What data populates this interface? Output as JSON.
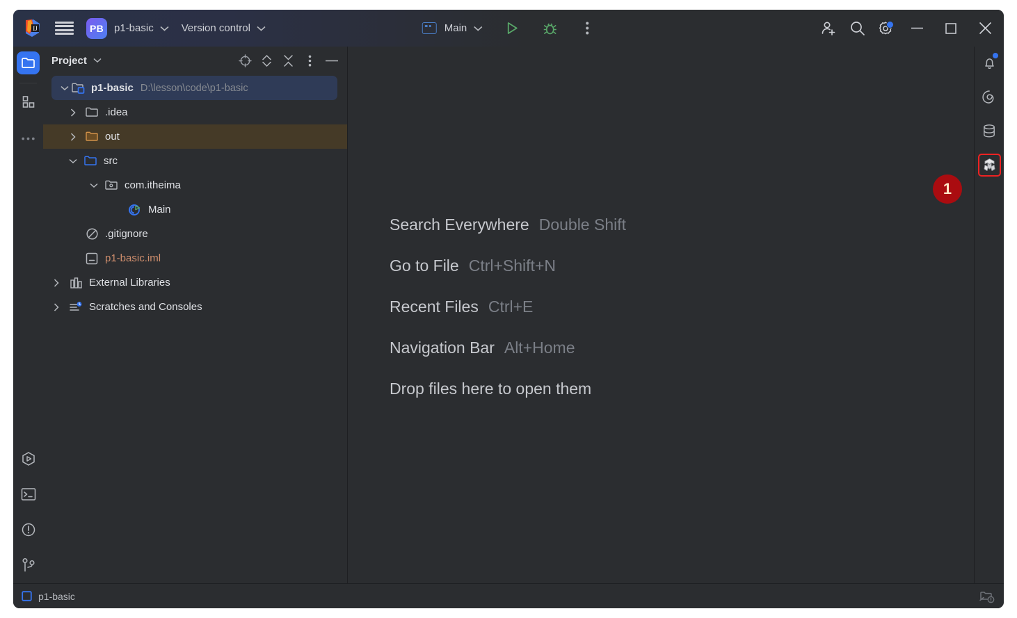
{
  "window": {
    "app_icon": "intellij-idea-logo",
    "minimize_label": "Minimize",
    "maximize_label": "Maximize",
    "close_label": "Close"
  },
  "toolbar": {
    "main_menu_icon": "hamburger-menu-icon",
    "project_badge": "PB",
    "project_name": "p1-basic",
    "vcs_label": "Version control",
    "run_config_name": "Main",
    "run_icon": "run-play-icon",
    "debug_icon": "debug-bug-icon",
    "more_icon": "more-vertical-icon",
    "account_icon": "add-account-icon",
    "search_icon": "search-icon",
    "settings_icon": "settings-gear-icon"
  },
  "left_rail": {
    "items": [
      {
        "name": "project",
        "icon": "folder-icon",
        "active": true
      },
      {
        "name": "structure",
        "icon": "blocks-icon",
        "active": false
      },
      {
        "name": "more-tool-windows",
        "icon": "ellipsis-icon",
        "active": false
      }
    ],
    "bottom_items": [
      {
        "name": "run",
        "icon": "run-hexagon-icon"
      },
      {
        "name": "terminal",
        "icon": "terminal-icon"
      },
      {
        "name": "problems",
        "icon": "problems-icon"
      },
      {
        "name": "version-control",
        "icon": "branch-icon"
      }
    ]
  },
  "project_panel": {
    "title": "Project",
    "actions": [
      {
        "name": "select-opened-file",
        "icon": "crosshair-icon"
      },
      {
        "name": "expand-collapse",
        "icon": "chevron-updown-icon"
      },
      {
        "name": "collapse-all",
        "icon": "collapse-all-icon"
      },
      {
        "name": "options-menu",
        "icon": "more-vertical-icon"
      },
      {
        "name": "hide-panel",
        "icon": "minimize-dash-icon"
      }
    ],
    "tree": [
      {
        "label": "p1-basic",
        "path": "D:\\lesson\\code\\p1-basic",
        "icon": "project-folder-icon",
        "indent": 0,
        "arrow": "down",
        "state": "selected",
        "bold": true
      },
      {
        "label": ".idea",
        "path": "",
        "icon": "folder-gray-icon",
        "indent": 1,
        "arrow": "right",
        "state": "normal",
        "bold": false
      },
      {
        "label": "out",
        "path": "",
        "icon": "folder-excluded-icon",
        "indent": 1,
        "arrow": "right",
        "state": "excluded",
        "bold": false
      },
      {
        "label": "src",
        "path": "",
        "icon": "folder-source-icon",
        "indent": 1,
        "arrow": "down",
        "state": "normal",
        "bold": false
      },
      {
        "label": "com.itheima",
        "path": "",
        "icon": "package-icon",
        "indent": 2,
        "arrow": "down",
        "state": "normal",
        "bold": false
      },
      {
        "label": "Main",
        "path": "",
        "icon": "java-class-runnable-icon",
        "indent": 3,
        "arrow": "none",
        "state": "normal",
        "bold": false
      },
      {
        "label": ".gitignore",
        "path": "",
        "icon": "gitignore-icon",
        "indent": 1,
        "arrow": "none",
        "state": "normal",
        "bold": false
      },
      {
        "label": "p1-basic.iml",
        "path": "",
        "icon": "module-iml-icon",
        "indent": 1,
        "arrow": "none",
        "state": "iml",
        "bold": false
      },
      {
        "label": "External Libraries",
        "path": "",
        "icon": "libraries-icon",
        "indent": 0,
        "arrow": "right",
        "state": "normal",
        "bold": false
      },
      {
        "label": "Scratches and Consoles",
        "path": "",
        "icon": "scratches-icon",
        "indent": 0,
        "arrow": "right",
        "state": "normal",
        "bold": false
      }
    ]
  },
  "editor": {
    "hints": [
      {
        "title": "Search Everywhere",
        "shortcut": "Double Shift"
      },
      {
        "title": "Go to File",
        "shortcut": "Ctrl+Shift+N"
      },
      {
        "title": "Recent Files",
        "shortcut": "Ctrl+E"
      },
      {
        "title": "Navigation Bar",
        "shortcut": "Alt+Home"
      },
      {
        "title": "Drop files here to open them",
        "shortcut": ""
      }
    ]
  },
  "right_rail": {
    "items": [
      {
        "name": "notifications",
        "icon": "bell-icon",
        "badge": true,
        "highlighted": false
      },
      {
        "name": "ai-assistant",
        "icon": "spiral-icon",
        "badge": false,
        "highlighted": false
      },
      {
        "name": "database",
        "icon": "database-icon",
        "badge": false,
        "highlighted": false
      },
      {
        "name": "maven",
        "icon": "maven-icon",
        "badge": false,
        "highlighted": true
      }
    ]
  },
  "annotation": {
    "step_number": "1"
  },
  "status_bar": {
    "project_icon": "module-square-icon",
    "project_name": "p1-basic",
    "right_icon": "file-sync-icon"
  },
  "colors": {
    "accent_blue": "#3574f0",
    "selection": "#2f3b57",
    "excluded": "#453a27",
    "background": "#2b2d30",
    "annotation_red": "#aa0c10",
    "highlight_border": "#ee2222",
    "text_primary": "#dfe1e5",
    "text_muted": "#868a91",
    "run_green": "#5fad65",
    "iml_orange": "#cf8e6d"
  }
}
